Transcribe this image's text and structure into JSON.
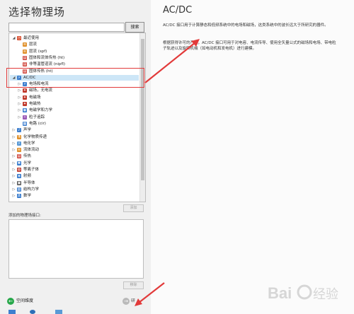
{
  "left": {
    "title": "选择物理场",
    "search_button": "搜索",
    "tree": [
      {
        "label": "最近使用",
        "indent": 0,
        "arrow": "◢",
        "icon": "◷",
        "icon_color": "#d84a2b",
        "selected": false
      },
      {
        "label": "层流",
        "indent": 1,
        "arrow": "",
        "icon": "≋",
        "icon_color": "#e0902a",
        "selected": false
      },
      {
        "label": "层流 (spf)",
        "indent": 1,
        "arrow": "",
        "icon": "≋",
        "icon_color": "#e0902a",
        "selected": false
      },
      {
        "label": "固体和流体传热 (ht)",
        "indent": 1,
        "arrow": "",
        "icon": "▤",
        "icon_color": "#d0463c",
        "selected": false
      },
      {
        "label": "非等温管道流 (nipfl)",
        "indent": 1,
        "arrow": "",
        "icon": "▤",
        "icon_color": "#d0463c",
        "selected": false
      },
      {
        "label": "固体传热 (ht)",
        "indent": 1,
        "arrow": "",
        "icon": "▤",
        "icon_color": "#d0463c",
        "selected": false
      },
      {
        "label": "AC/DC",
        "indent": 0,
        "arrow": "◢",
        "icon": "⚡",
        "icon_color": "#3d7fcf",
        "selected": true
      },
      {
        "label": "电场和电流",
        "indent": 1,
        "arrow": "▷",
        "icon": "⚡",
        "icon_color": "#3d7fcf",
        "selected": false
      },
      {
        "label": "磁场，无电流",
        "indent": 1,
        "arrow": "▷",
        "icon": "✦",
        "icon_color": "#c0392b",
        "selected": false
      },
      {
        "label": "电磁场",
        "indent": 1,
        "arrow": "▷",
        "icon": "✦",
        "icon_color": "#c0392b",
        "selected": false
      },
      {
        "label": "电磁热",
        "indent": 1,
        "arrow": "▷",
        "icon": "✦",
        "icon_color": "#c0392b",
        "selected": false
      },
      {
        "label": "电磁学和力学",
        "indent": 1,
        "arrow": "▷",
        "icon": "◉",
        "icon_color": "#3d7fcf",
        "selected": false
      },
      {
        "label": "粒子追踪",
        "indent": 1,
        "arrow": "▷",
        "icon": "✧",
        "icon_color": "#9b59b6",
        "selected": false
      },
      {
        "label": "电路 (cir)",
        "indent": 1,
        "arrow": "",
        "icon": "▦",
        "icon_color": "#3d7fcf",
        "selected": false
      },
      {
        "label": "声学",
        "indent": 0,
        "arrow": "▷",
        "icon": "♪",
        "icon_color": "#3d7fcf",
        "selected": false
      },
      {
        "label": "化学物质传递",
        "indent": 0,
        "arrow": "▷",
        "icon": "⚗",
        "icon_color": "#e0902a",
        "selected": false
      },
      {
        "label": "电化学",
        "indent": 0,
        "arrow": "▷",
        "icon": "⚡",
        "icon_color": "#5a9ad6",
        "selected": false
      },
      {
        "label": "流体流动",
        "indent": 0,
        "arrow": "▷",
        "icon": "≋",
        "icon_color": "#e0902a",
        "selected": false
      },
      {
        "label": "传热",
        "indent": 0,
        "arrow": "▷",
        "icon": "▤",
        "icon_color": "#d0463c",
        "selected": false
      },
      {
        "label": "光学",
        "indent": 0,
        "arrow": "▷",
        "icon": "✺",
        "icon_color": "#3d7fcf",
        "selected": false
      },
      {
        "label": "等离子体",
        "indent": 0,
        "arrow": "▷",
        "icon": "◍",
        "icon_color": "#c0392b",
        "selected": false
      },
      {
        "label": "射频",
        "indent": 0,
        "arrow": "▷",
        "icon": "◈",
        "icon_color": "#3d7fcf",
        "selected": false
      },
      {
        "label": "半导体",
        "indent": 0,
        "arrow": "▷",
        "icon": "▣",
        "icon_color": "#555555",
        "selected": false
      },
      {
        "label": "结构力学",
        "indent": 0,
        "arrow": "▷",
        "icon": "▥",
        "icon_color": "#3d7fcf",
        "selected": false
      },
      {
        "label": "数学",
        "indent": 0,
        "arrow": "▷",
        "icon": "Δ",
        "icon_color": "#3d7fcf",
        "selected": false
      }
    ],
    "add_button": "添加",
    "added_label": "添加的物理场接口:",
    "remove_button": "移除",
    "back_button": "空间维度",
    "next_button": "研"
  },
  "right": {
    "title": "AC/DC",
    "paragraph1": "AC/DC 接口用于计算静态和低频系统中的电场和磁场，这类系统中的波长远大于所研究的器件。",
    "paragraph2": "根据获得许可的产品，AC/DC 接口可用于对电容、电流传导、使用全矢量公式的磁场和电场、带电粒子轨迹以及旋转机械（如电动机和发电机）进行建模。"
  },
  "watermark": "Bai 经验"
}
